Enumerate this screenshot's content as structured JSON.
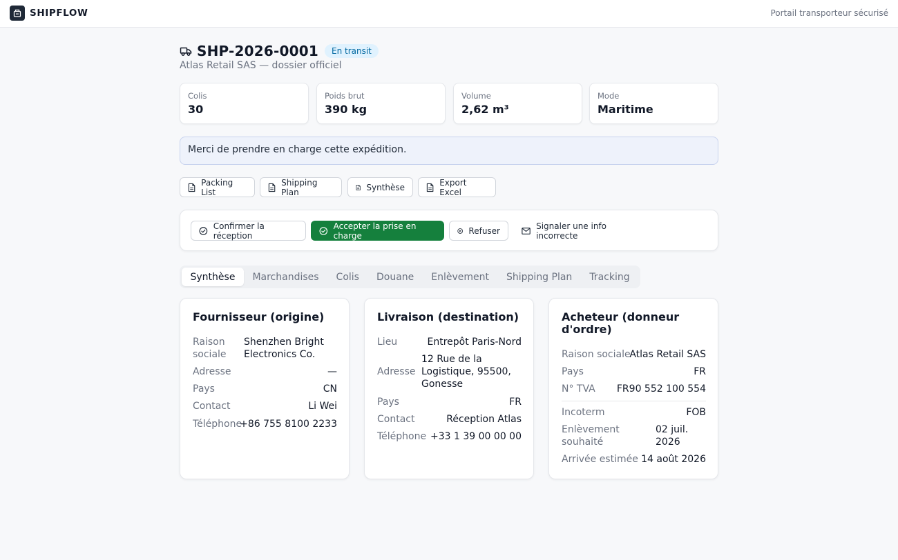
{
  "header": {
    "brand": "SHIPFLOW",
    "portal_label": "Portail transporteur sécurisé"
  },
  "shipment": {
    "id": "SHP-2026-0001",
    "status": "En transit",
    "subtitle": "Atlas Retail SAS — dossier officiel"
  },
  "metrics": [
    {
      "label": "Colis",
      "value": "30"
    },
    {
      "label": "Poids brut",
      "value": "390 kg"
    },
    {
      "label": "Volume",
      "value": "2,62 m³"
    },
    {
      "label": "Mode",
      "value": "Maritime"
    }
  ],
  "message": "Merci de prendre en charge cette expédition.",
  "documents": [
    "Packing List",
    "Shipping Plan",
    "Synthèse",
    "Export Excel"
  ],
  "actions": {
    "confirm": "Confirmer la réception",
    "accept": "Accepter la prise en charge",
    "refuse": "Refuser",
    "report": "Signaler une info incorrecte"
  },
  "tabs": [
    "Synthèse",
    "Marchandises",
    "Colis",
    "Douane",
    "Enlèvement",
    "Shipping Plan",
    "Tracking"
  ],
  "active_tab": "Synthèse",
  "supplier": {
    "title": "Fournisseur (origine)",
    "company_label": "Raison sociale",
    "company_label_l1": "Raison",
    "company_label_l2": "sociale",
    "company_l1": "Shenzhen Bright",
    "company_l2": "Electronics Co.",
    "address_label": "Adresse",
    "address": "—",
    "country_label": "Pays",
    "country": "CN",
    "contact_label": "Contact",
    "contact": "Li Wei",
    "phone_label": "Téléphone",
    "phone": "+86 755 8100 2233"
  },
  "delivery": {
    "title": "Livraison (destination)",
    "place_label": "Lieu",
    "place": "Entrepôt Paris-Nord",
    "address_label": "Adresse",
    "address_l1": "12 Rue de la",
    "address_l2": "Logistique, 95500,",
    "address_l3": "Gonesse",
    "country_label": "Pays",
    "country": "FR",
    "contact_label": "Contact",
    "contact": "Réception Atlas",
    "phone_label": "Téléphone",
    "phone": "+33 1 39 00 00 00"
  },
  "buyer": {
    "title_l1": "Acheteur (donneur",
    "title_l2": "d'ordre)",
    "company_label": "Raison sociale",
    "company": "Atlas Retail SAS",
    "country_label": "Pays",
    "country": "FR",
    "vat_label": "N° TVA",
    "vat": "FR90 552 100 554",
    "incoterm_label": "Incoterm",
    "incoterm": "FOB",
    "pickup_label_l1": "Enlèvement",
    "pickup_label_l2": "souhaité",
    "pickup_l1": "02 juil.",
    "pickup_l2": "2026",
    "arrival_label": "Arrivée estimée",
    "arrival": "14 août 2026"
  },
  "colors": {
    "accent_green": "#15803d",
    "badge_bg": "#e0f2fe",
    "badge_text": "#0369a1",
    "message_bg": "#eef2fb"
  },
  "icons": {
    "brand": "package-logo-icon",
    "title": "truck-icon",
    "documents": "file-text-icon",
    "confirm": "check-circle-icon",
    "accept": "check-circle-icon",
    "refuse": "x-circle-icon",
    "report": "mail-icon"
  }
}
